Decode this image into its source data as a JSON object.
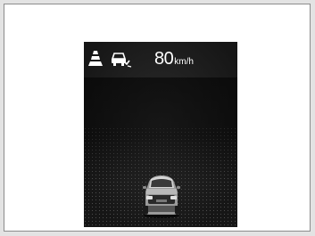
{
  "speed": {
    "value": "80",
    "unit": "km/h"
  },
  "icons": {
    "lane": "lane-keeping-icon",
    "following": "vehicle-following-icon",
    "car": "own-vehicle-icon"
  },
  "colors": {
    "background": "#e3e3e3",
    "display": "#1b1b1b",
    "text": "#ffffff"
  }
}
